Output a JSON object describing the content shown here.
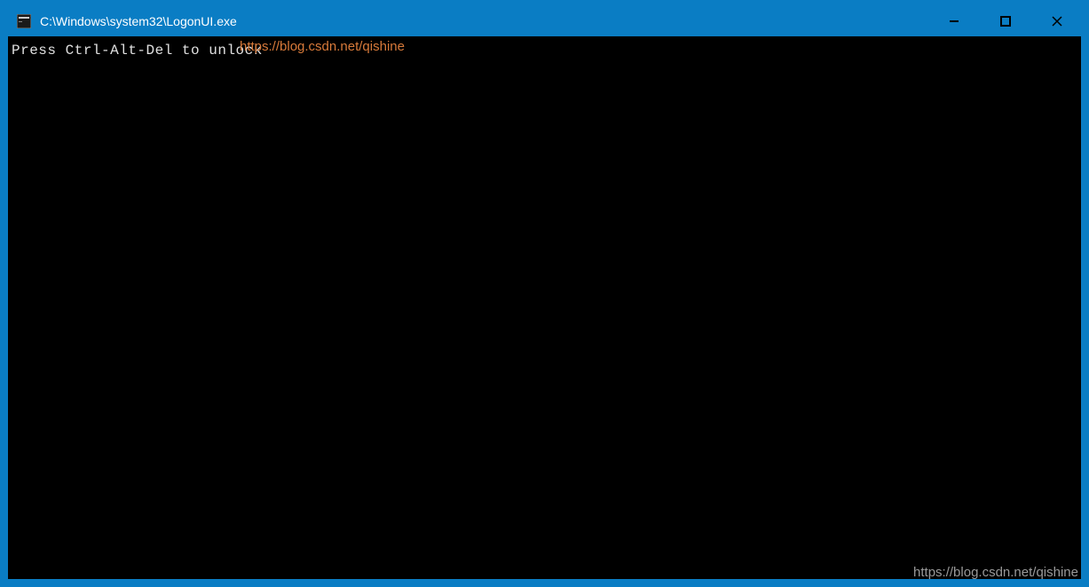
{
  "window": {
    "title": "C:\\Windows\\system32\\LogonUI.exe"
  },
  "console": {
    "line1": "Press Ctrl-Alt-Del to unlock"
  },
  "watermark": {
    "url_top": "https://blog.csdn.net/qishine",
    "url_bottom": "https://blog.csdn.net/qishine"
  }
}
